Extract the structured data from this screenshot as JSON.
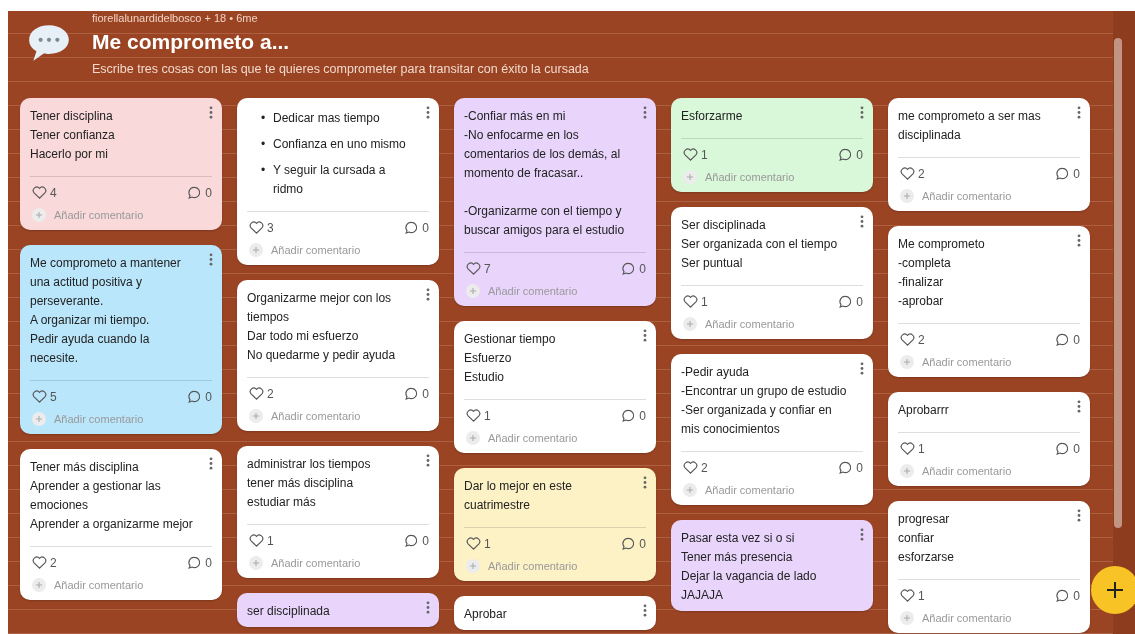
{
  "header": {
    "author": "fiorellalunardidelbosco + 18 • 6me",
    "title": "Me comprometo a...",
    "description": "Escribe tres cosas con las que te quieres comprometer para transitar con éxito la cursada"
  },
  "columns": [
    {
      "cards": [
        {
          "kind": "text",
          "color": "#f9d9d9",
          "text": "Tener disciplina\nTener confianza\nHacerlo por mi",
          "likes": "4",
          "comments": "0",
          "add_comment": "Añadir comentario"
        },
        {
          "kind": "text",
          "color": "#b9e6fa",
          "text": "Me comprometo a mantener una actitud positiva y perseverante.\nA organizar mi tiempo.\nPedir ayuda cuando la necesite.",
          "likes": "5",
          "comments": "0",
          "add_comment": "Añadir comentario"
        },
        {
          "kind": "text",
          "color": "#ffffff",
          "text": "Tener más disciplina\nAprender a gestionar las emociones\nAprender a organizarme mejor",
          "likes": "2",
          "comments": "0",
          "add_comment": "Añadir comentario"
        }
      ]
    },
    {
      "cards": [
        {
          "kind": "bullets",
          "color": "#ffffff",
          "items": [
            {
              "marker": "•",
              "text": "Dedicar mas tiempo"
            },
            {
              "marker": "•",
              "text": "Confianza en uno mismo"
            },
            {
              "marker": "•",
              "text": "Y seguir la cursada a ridmo"
            }
          ],
          "likes": "3",
          "comments": "0",
          "add_comment": "Añadir comentario"
        },
        {
          "kind": "text",
          "color": "#ffffff",
          "text": "Organizarme mejor con los tiempos\nDar todo mi esfuerzo\nNo quedarme y pedir ayuda",
          "likes": "2",
          "comments": "0",
          "add_comment": "Añadir comentario"
        },
        {
          "kind": "text",
          "color": "#ffffff",
          "text": "administrar los tiempos\ntener más disciplina\nestudiar más",
          "likes": "1",
          "comments": "0",
          "add_comment": "Añadir comentario"
        },
        {
          "kind": "text",
          "color": "#e9d5fc",
          "text": "ser disciplinada"
        }
      ]
    },
    {
      "cards": [
        {
          "kind": "text",
          "color": "#e9d5fc",
          "text": "-Confiar más en mi\n-No enfocarme en los comentarios de los demás, al momento de fracasar..\n\n-Organizarme con el tiempo y buscar amigos para el estudio",
          "likes": "7",
          "comments": "0",
          "add_comment": "Añadir comentario"
        },
        {
          "kind": "text",
          "color": "#ffffff",
          "text": "Gestionar tiempo\nEsfuerzo\nEstudio",
          "likes": "1",
          "comments": "0",
          "add_comment": "Añadir comentario"
        },
        {
          "kind": "text",
          "color": "#fdf1c6",
          "text": "Dar lo mejor en este cuatrimestre",
          "likes": "1",
          "comments": "0",
          "add_comment": "Añadir comentario"
        },
        {
          "kind": "text",
          "color": "#ffffff",
          "text": "Aprobar"
        }
      ]
    },
    {
      "cards": [
        {
          "kind": "text",
          "color": "#d9f7d9",
          "text": "Esforzarme",
          "likes": "1",
          "comments": "0",
          "add_comment": "Añadir comentario"
        },
        {
          "kind": "text",
          "color": "#ffffff",
          "text": "Ser disciplinada\nSer organizada con el tiempo\nSer puntual",
          "likes": "1",
          "comments": "0",
          "add_comment": "Añadir comentario"
        },
        {
          "kind": "text",
          "color": "#ffffff",
          "text": "-Pedir ayuda\n-Encontrar un grupo de estudio\n-Ser organizada y confiar en mis conocimientos",
          "likes": "2",
          "comments": "0",
          "add_comment": "Añadir comentario"
        },
        {
          "kind": "text",
          "color": "#e9d5fc",
          "text": "Pasar esta vez si o si\nTener más presencia\nDejar la vagancia de lado\nJAJAJA"
        }
      ]
    },
    {
      "cards": [
        {
          "kind": "text",
          "color": "#ffffff",
          "text": "me comprometo a ser mas disciplinada",
          "likes": "2",
          "comments": "0",
          "add_comment": "Añadir comentario"
        },
        {
          "kind": "text",
          "color": "#ffffff",
          "text": "Me comprometo\n-completa\n-finalizar\n-aprobar",
          "likes": "2",
          "comments": "0",
          "add_comment": "Añadir comentario"
        },
        {
          "kind": "text",
          "color": "#ffffff",
          "text": "Aprobarrr",
          "likes": "1",
          "comments": "0",
          "add_comment": "Añadir comentario"
        },
        {
          "kind": "text",
          "color": "#ffffff",
          "text": "progresar\nconfiar\nesforzarse",
          "likes": "1",
          "comments": "0",
          "add_comment": "Añadir comentario"
        }
      ]
    }
  ]
}
